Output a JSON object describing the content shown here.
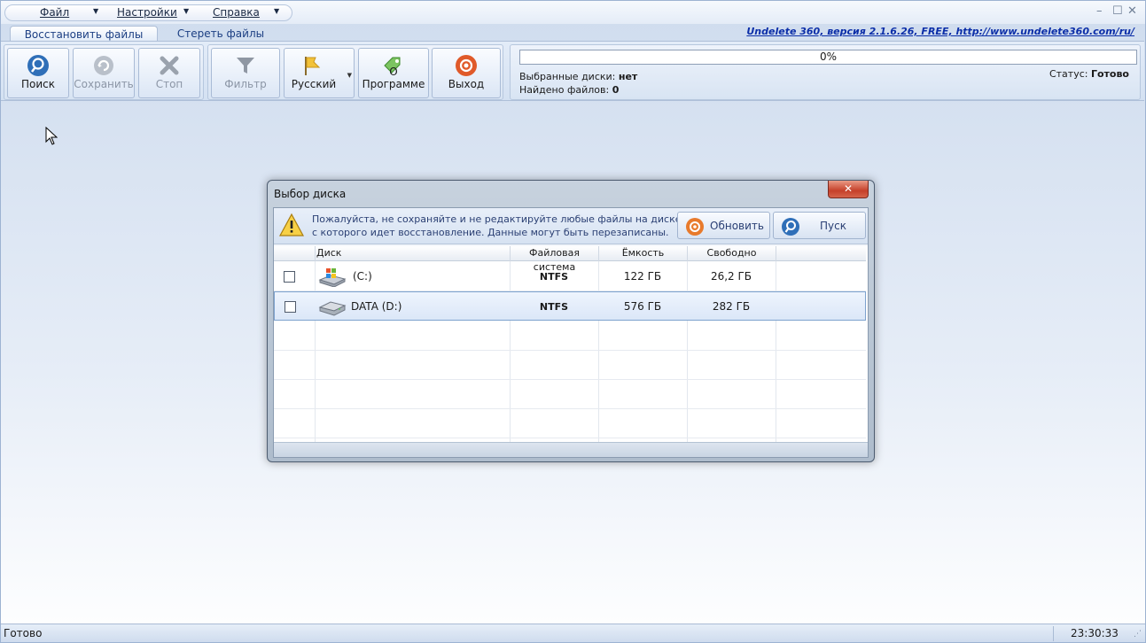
{
  "menu": {
    "file": "Файл",
    "settings": "Настройки",
    "help": "Справка"
  },
  "tabs": [
    {
      "label": "Восстановить файлы",
      "active": true
    },
    {
      "label": "Стереть файлы",
      "active": false
    }
  ],
  "version_link": "Undelete 360, версия 2.1.6.26, FREE, http://www.undelete360.com/ru/",
  "toolbar": {
    "search": "Поиск",
    "save": "Сохранить",
    "stop": "Стоп",
    "filter": "Фильтр",
    "language": "Русский",
    "about": "О Программе",
    "exit": "Выход"
  },
  "progress": {
    "text": "0%",
    "value": 0
  },
  "info": {
    "selected_disks_label": "Выбранные диски:",
    "selected_disks_value": "нет",
    "files_found_label": "Найдено файлов:",
    "files_found_value": "0",
    "status_label": "Статус:",
    "status_value": "Готово"
  },
  "dialog": {
    "title": "Выбор диска",
    "warning_line1": "Пожалуйста, не сохраняйте и не редактируйте любые файлы на диске,",
    "warning_line2": "с которого идет восстановление. Данные могут быть перезаписаны.",
    "refresh_button": "Обновить",
    "start_button": "Пуск",
    "columns": [
      "Диск",
      "Файловая система",
      "Ёмкость",
      "Свободно"
    ],
    "rows": [
      {
        "disk": "(C:)",
        "fs": "NTFS",
        "capacity": "122 ГБ",
        "free": "26,2 ГБ",
        "checked": false,
        "selected": false,
        "icon": "windows-drive-icon"
      },
      {
        "disk": "DATA (D:)",
        "fs": "NTFS",
        "capacity": "576 ГБ",
        "free": "282 ГБ",
        "checked": false,
        "selected": true,
        "icon": "hard-drive-icon"
      }
    ]
  },
  "statusbar": {
    "text": "Готово",
    "time": "23:30:33"
  },
  "colors": {
    "accent": "#1c3f83",
    "link": "#0b2ea8",
    "close_button": "#c5402a"
  }
}
